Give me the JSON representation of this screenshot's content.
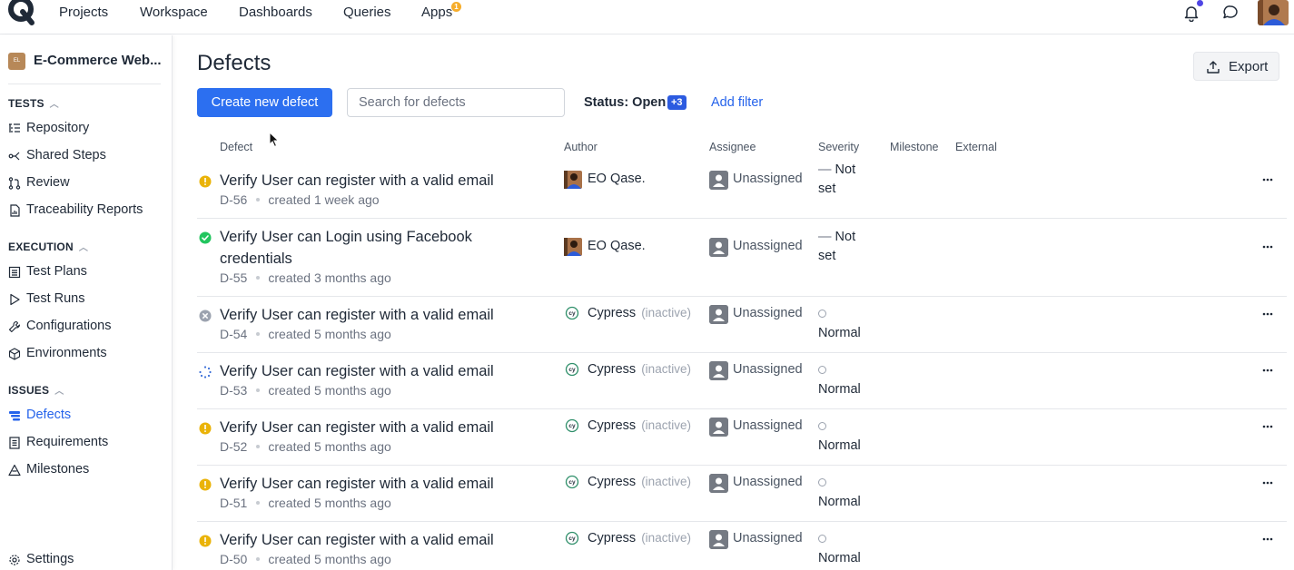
{
  "topnav": {
    "items": [
      "Projects",
      "Workspace",
      "Dashboards",
      "Queries",
      "Apps"
    ],
    "apps_badge": "1",
    "icons": [
      "qase-logo-icon",
      "bell-icon",
      "chat-icon",
      "user-avatar"
    ]
  },
  "sidebar": {
    "project_initials": "EL",
    "project_name": "E-Commerce Web...",
    "sections": [
      {
        "title": "TESTS",
        "items": [
          "Repository",
          "Shared Steps",
          "Review",
          "Traceability Reports"
        ]
      },
      {
        "title": "EXECUTION",
        "items": [
          "Test Plans",
          "Test Runs",
          "Configurations",
          "Environments"
        ]
      },
      {
        "title": "ISSUES",
        "items": [
          "Defects",
          "Requirements",
          "Milestones"
        ]
      }
    ],
    "active_item": "Defects",
    "settings_label": "Settings"
  },
  "page": {
    "title": "Defects",
    "export_label": "Export",
    "create_label": "Create new defect",
    "search_placeholder": "Search for defects",
    "status_filter_label": "Status: Open",
    "status_filter_count": "+3",
    "add_filter_label": "Add filter"
  },
  "table": {
    "columns": [
      "Defect",
      "Author",
      "Assignee",
      "Severity",
      "Milestone",
      "External"
    ],
    "rows": [
      {
        "status": "open",
        "title": "Verify User can register with a valid email",
        "id": "D-56",
        "created": "created 1 week ago",
        "author": "EO Qase.",
        "author_inactive": "",
        "assignee": "Unassigned",
        "severity": "Not set"
      },
      {
        "status": "resolved",
        "title": "Verify User can Login using Facebook credentials",
        "id": "D-55",
        "created": "created 3 months ago",
        "author": "EO Qase.",
        "author_inactive": "",
        "assignee": "Unassigned",
        "severity": "Not set"
      },
      {
        "status": "invalid",
        "title": "Verify User can register with a valid email",
        "id": "D-54",
        "created": "created 5 months ago",
        "author": "Cypress",
        "author_inactive": "(inactive)",
        "assignee": "Unassigned",
        "severity": "Normal"
      },
      {
        "status": "in-progress",
        "title": "Verify User can register with a valid email",
        "id": "D-53",
        "created": "created 5 months ago",
        "author": "Cypress",
        "author_inactive": "(inactive)",
        "assignee": "Unassigned",
        "severity": "Normal"
      },
      {
        "status": "open",
        "title": "Verify User can register with a valid email",
        "id": "D-52",
        "created": "created 5 months ago",
        "author": "Cypress",
        "author_inactive": "(inactive)",
        "assignee": "Unassigned",
        "severity": "Normal"
      },
      {
        "status": "open",
        "title": "Verify User can register with a valid email",
        "id": "D-51",
        "created": "created 5 months ago",
        "author": "Cypress",
        "author_inactive": "(inactive)",
        "assignee": "Unassigned",
        "severity": "Normal"
      },
      {
        "status": "open",
        "title": "Verify User can register with a valid email",
        "id": "D-50",
        "created": "created 5 months ago",
        "author": "Cypress",
        "author_inactive": "(inactive)",
        "assignee": "Unassigned",
        "severity": "Normal"
      }
    ]
  },
  "colors": {
    "primary": "#2c6ff0",
    "link": "#2563eb",
    "status_open": "#eab308",
    "status_resolved": "#22c55e",
    "status_invalid": "#9ca3af",
    "status_in_progress": "#3b6fd8"
  }
}
